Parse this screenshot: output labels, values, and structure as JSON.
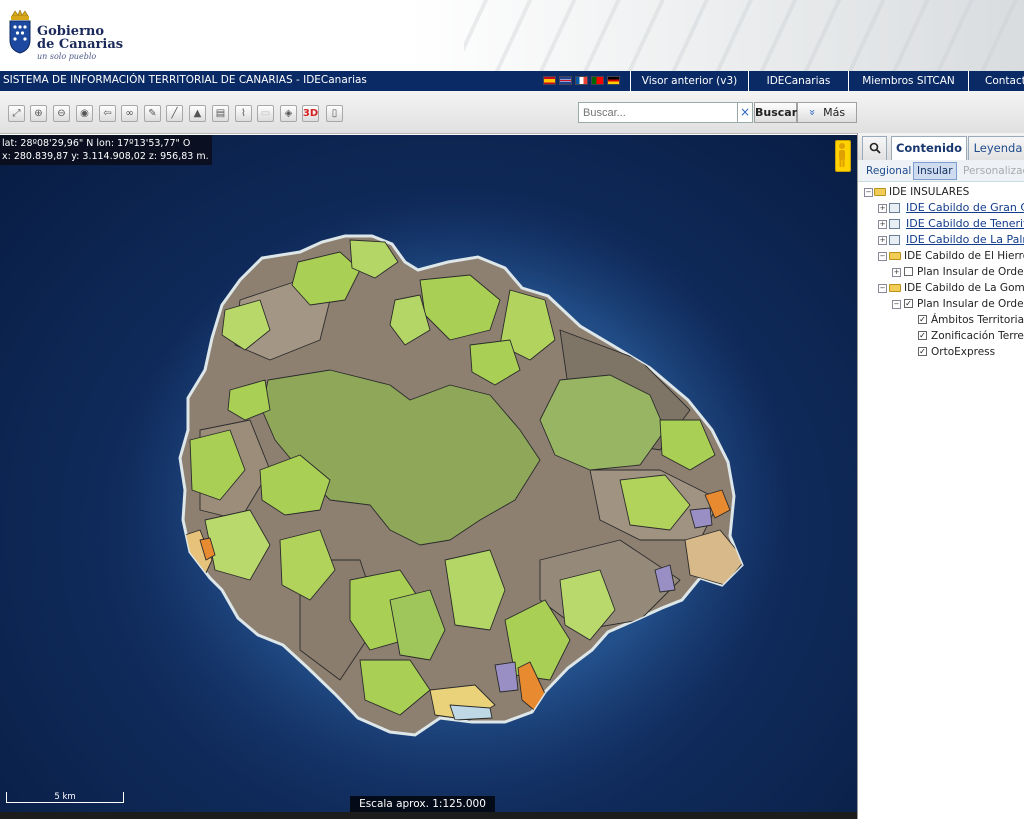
{
  "header": {
    "org_name_line1": "Gobierno",
    "org_name_line2": "de Canarias",
    "org_slogan": "un solo pueblo"
  },
  "navbar": {
    "title": "SISTEMA DE INFORMACIÓN TERRITORIAL DE CANARIAS - IDECanarias",
    "languages": [
      "es",
      "en",
      "fr",
      "pt",
      "de"
    ],
    "links": [
      "Visor anterior (v3)",
      "IDECanarias",
      "Miembros SITCAN",
      "Contacto"
    ]
  },
  "toolbar": {
    "tool_icons": [
      "zoom-extent-icon",
      "zoom-in-icon",
      "zoom-out-icon",
      "pan-icon",
      "back-icon",
      "link-icon",
      "draw-icon",
      "measure-icon",
      "profile-icon",
      "print-icon",
      "route-icon",
      "export-icon",
      "layers-icon",
      "3d-icon",
      "split-icon"
    ],
    "three_d_label": "3D",
    "search_placeholder": "Buscar...",
    "search_button": "Buscar",
    "more_button": "Más",
    "more_chevron": "»",
    "clear_symbol": "×"
  },
  "map": {
    "coords_line1": "lat: 28º08'29,96\" N  lon: 17º13'53,77\" O",
    "coords_line2": "x: 280.839,87  y: 3.114.908,02  z: 956,83 m.",
    "scalebar_label": "5 km",
    "scale_text": "Escala aprox. 1:125.000"
  },
  "panel": {
    "tabs": [
      "Contenido",
      "Leyenda"
    ],
    "active_tab": "Contenido",
    "subtabs": [
      "Regional",
      "Insular",
      "Personalizado"
    ],
    "active_subtab": "Insular",
    "tree": [
      {
        "label": "IDE INSULARES",
        "expander": "−",
        "kind": "folder"
      },
      {
        "label": "IDE Cabildo de Gran Canaria",
        "expander": "+",
        "kind": "link"
      },
      {
        "label": "IDE Cabildo de Tenerife",
        "expander": "+",
        "kind": "link"
      },
      {
        "label": "IDE Cabildo de La Palma",
        "expander": "+",
        "kind": "link"
      },
      {
        "label": "IDE Cabildo de El Hierro",
        "expander": "−",
        "kind": "folder"
      },
      {
        "label": "Plan Insular de Ordenación",
        "expander": "+",
        "kind": "check",
        "checked": false
      },
      {
        "label": "IDE Cabildo de La Gomera",
        "expander": "−",
        "kind": "folder"
      },
      {
        "label": "Plan Insular de Ordenación",
        "expander": "−",
        "kind": "check",
        "checked": true
      },
      {
        "label": "Ámbitos Territoriales",
        "kind": "check",
        "checked": true
      },
      {
        "label": "Zonificación Terrestre",
        "kind": "check",
        "checked": true
      },
      {
        "label": "OrtoExpress",
        "kind": "check",
        "checked": true
      }
    ]
  },
  "colors": {
    "navbar_bg": "#0a2a66",
    "zone_light_green": "#a9cf55",
    "zone_olive": "#8ea759",
    "zone_brown_gray": "#8d8071",
    "zone_orange": "#e88a2f",
    "zone_purple": "#9a8fc4",
    "ocean": "#1b3f77"
  }
}
